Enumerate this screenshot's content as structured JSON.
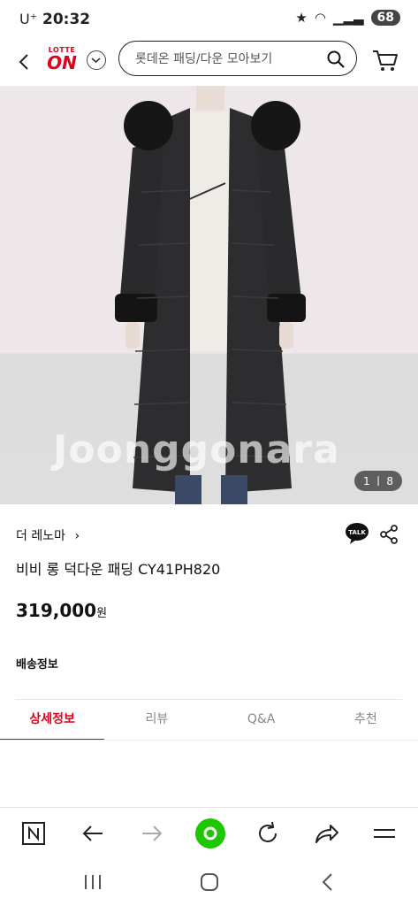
{
  "status": {
    "carrier": "U⁺",
    "time": "20:32",
    "battery": "68"
  },
  "header": {
    "logo_top": "LOTTE",
    "logo_bottom": "ON",
    "search_placeholder": "롯데온 패딩/다운 모아보기"
  },
  "product": {
    "watermark": "Joonggonara",
    "image_counter": "1 ㅣ 8",
    "brand": "더 레노마",
    "name": "비비 롱 덕다운 패딩 CY41PH820",
    "price": "319,000",
    "currency": "원",
    "shipping_label": "배송정보",
    "talk_label": "TALK"
  },
  "tabs": [
    {
      "label": "상세정보",
      "active": true
    },
    {
      "label": "리뷰",
      "active": false
    },
    {
      "label": "Q&A",
      "active": false
    },
    {
      "label": "추천",
      "active": false
    }
  ],
  "colors": {
    "accent": "#e0001b",
    "browser_green": "#1ec800"
  }
}
